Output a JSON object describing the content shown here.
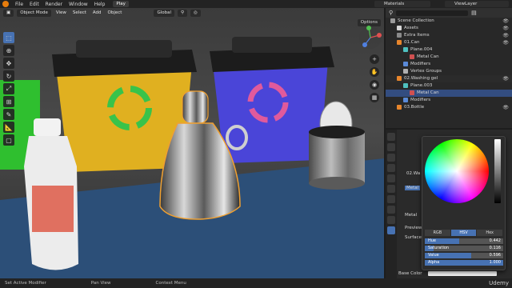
{
  "topbar": {
    "menus": [
      "File",
      "Edit",
      "Render",
      "Window",
      "Help"
    ],
    "workspace_tab": "Play",
    "scene_field": "Materials",
    "viewlayer_field": "ViewLayer"
  },
  "viewport": {
    "mode": "Object Mode",
    "menus": [
      "View",
      "Select",
      "Add",
      "Object"
    ],
    "transform_orientation": "Global",
    "options_label": "Options"
  },
  "outliner": {
    "rows": [
      {
        "label": "Scene Collection",
        "icon": "collection-icon",
        "color": "#9a9a9a",
        "indent": 0
      },
      {
        "label": "Assets",
        "icon": "collection-icon",
        "color": "#d8d8d8",
        "indent": 1
      },
      {
        "label": "Extra Items",
        "icon": "collection-icon",
        "color": "#8a8a8a",
        "indent": 1
      },
      {
        "label": "01.Can",
        "icon": "object-icon",
        "color": "#e8862c",
        "indent": 1
      },
      {
        "label": "Plane.004",
        "icon": "mesh-icon",
        "color": "#4fc1c0",
        "indent": 2
      },
      {
        "label": "Metal Can",
        "icon": "material-icon",
        "color": "#d05050",
        "indent": 3
      },
      {
        "label": "Modifiers",
        "icon": "wrench-icon",
        "color": "#5a8ad8",
        "indent": 2
      },
      {
        "label": "Vertex Groups",
        "icon": "vertex-group-icon",
        "color": "#b0b0b0",
        "indent": 2
      },
      {
        "label": "02.Washing gel",
        "icon": "object-icon",
        "color": "#e8862c",
        "indent": 1
      },
      {
        "label": "Plane.003",
        "icon": "mesh-icon",
        "color": "#4fc1c0",
        "indent": 2
      },
      {
        "label": "Metal Can",
        "icon": "material-icon",
        "color": "#d05050",
        "indent": 3
      },
      {
        "label": "Modifiers",
        "icon": "wrench-icon",
        "color": "#5a8ad8",
        "indent": 2
      },
      {
        "label": "03.Bottle",
        "icon": "object-icon",
        "color": "#e8862c",
        "indent": 1
      }
    ],
    "selected_index": 10,
    "highlight_index": 8
  },
  "properties": {
    "object_field": "02.Wa",
    "material_label": "Metal",
    "preview_label": "Preview",
    "surface_label": "Surface",
    "base_color_label": "Base Color"
  },
  "color_picker": {
    "modes": [
      "RGB",
      "HSV",
      "Hex"
    ],
    "active_mode": "HSV",
    "fields": [
      {
        "label": "Hue",
        "value": "0.442",
        "fraction": 0.442
      },
      {
        "label": "Saturation",
        "value": "0.116",
        "fraction": 0.116
      },
      {
        "label": "Value",
        "value": "0.596",
        "fraction": 0.596
      },
      {
        "label": "Alpha",
        "value": "1.000",
        "fraction": 1.0
      }
    ]
  },
  "statusbar": {
    "items": [
      "Set Active Modifier",
      "Pan View",
      "Context Menu"
    ],
    "watermark": "Udemy"
  },
  "colors": {
    "accent": "#4772b3",
    "selection_outline": "#f0a030",
    "yellow_bin": "#e0b020",
    "blue_bin": "#4a45d8",
    "recycle_green": "#39c34a",
    "recycle_pink": "#e05a9c",
    "table_blue": "#2c4f78"
  }
}
